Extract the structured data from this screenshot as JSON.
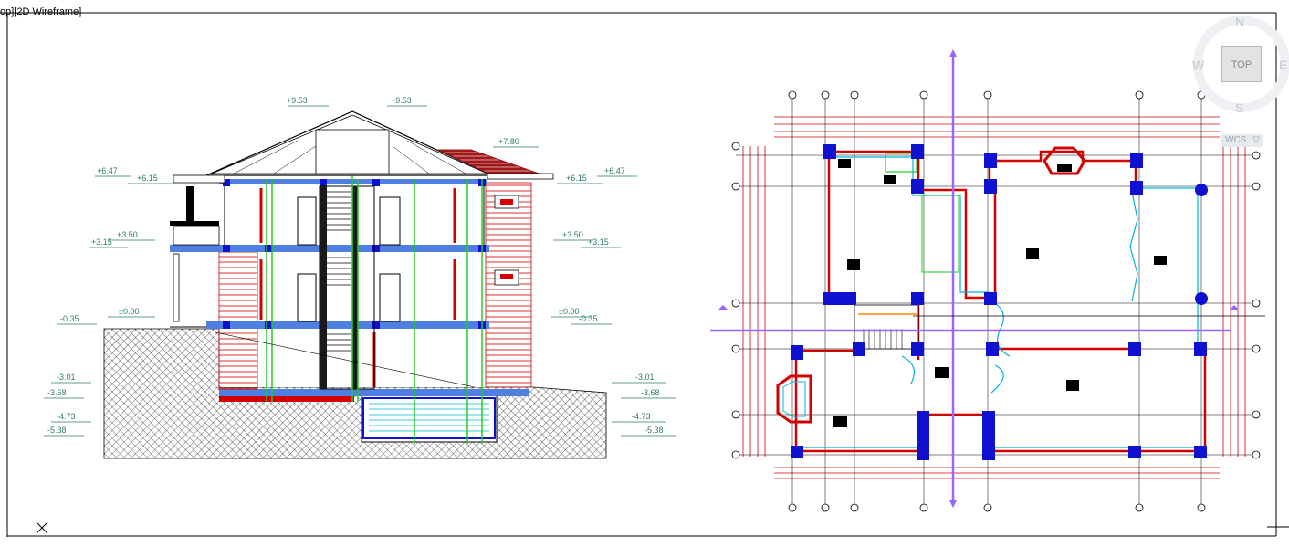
{
  "viewport": {
    "view_label": "op][2D Wireframe]"
  },
  "viewcube": {
    "face": "TOP",
    "north": "N",
    "south": "S",
    "west": "W",
    "east": "E"
  },
  "wcs": {
    "label": "WCS",
    "caret": "▽"
  },
  "section": {
    "levels_left": [
      "+6.47",
      "+6.15",
      "+3.15",
      "+3.50",
      "-0.35",
      "±0.00",
      "-3.01",
      "-3.68",
      "-4.73",
      "-5.38"
    ],
    "levels_right": [
      "+6.15",
      "+6.47",
      "+3.50",
      "+3.15",
      "±0.00",
      "-0.35",
      "-3.01",
      "-3.68",
      "-4.73",
      "-5.38"
    ],
    "levels_top": [
      "+9.53",
      "+9.53",
      "+7.80"
    ]
  },
  "colors": {
    "background": "#ffffff",
    "wall_red": "#d40000",
    "structure_blue": "#1010d0",
    "grid_green": "#22cc22",
    "level_text": "#2e7d5a",
    "roof_tile": "#a01818",
    "section_axis": "#9966ff",
    "cyan_lines": "#00b4d8"
  }
}
